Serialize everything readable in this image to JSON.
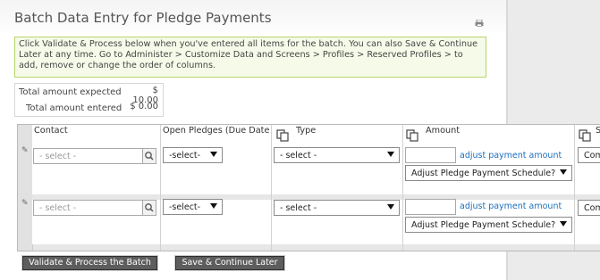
{
  "page": {
    "title": "Batch Data Entry for Pledge Payments"
  },
  "help_text": "Click Validate & Process below when you've entered all items for the batch. You can also Save & Continue Later at any time. Go to Administer > Customize Data and Screens > Profiles > Reserved Profiles > to add, remove or change the order of columns.",
  "totals": {
    "expected_label": "Total amount expected",
    "expected_value": "$ 10.00",
    "entered_label": "Total amount entered",
    "entered_value": "$ 0.00"
  },
  "grid": {
    "columns": {
      "contact": "Contact",
      "open_pledges": "Open Pledges (Due Date - Amount)",
      "type": "Type",
      "amount": "Amount",
      "source": "S"
    },
    "rows": [
      {
        "contact_placeholder": "- select -",
        "pledge_value": "-select-",
        "type_value": "- select -",
        "amount_value": "",
        "adjust_link": "adjust payment amount",
        "schedule_value": "Adjust Pledge Payment Schedule?",
        "extra_value": "Com"
      },
      {
        "contact_placeholder": "- select -",
        "pledge_value": "-select-",
        "type_value": "- select -",
        "amount_value": "",
        "adjust_link": "adjust payment amount",
        "schedule_value": "Adjust Pledge Payment Schedule?",
        "extra_value": "Com"
      }
    ]
  },
  "buttons": {
    "validate": "Validate & Process the Batch",
    "save": "Save & Continue Later"
  }
}
